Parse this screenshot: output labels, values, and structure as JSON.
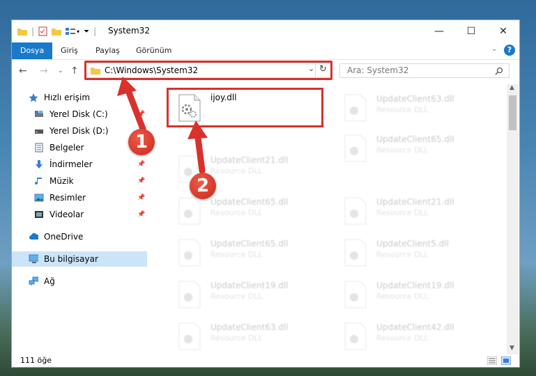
{
  "window": {
    "title": "System32",
    "controls": {
      "minimize": "—",
      "maximize": "☐",
      "close": "✕"
    }
  },
  "ribbon": {
    "tabs": [
      {
        "label": "Dosya",
        "active": true
      },
      {
        "label": "Giriş",
        "active": false
      },
      {
        "label": "Paylaş",
        "active": false
      },
      {
        "label": "Görünüm",
        "active": false
      }
    ],
    "help": "?"
  },
  "address": {
    "path": "C:\\Windows\\System32",
    "highlight_color": "#d9312b"
  },
  "search": {
    "placeholder": "Ara: System32"
  },
  "sidebar": {
    "items": [
      {
        "label": "Hızlı erişim",
        "icon": "star-icon"
      },
      {
        "label": "Yerel Disk (C:)",
        "icon": "drive-icon"
      },
      {
        "label": "Yerel Disk (D:)",
        "icon": "drive-icon"
      },
      {
        "label": "Belgeler",
        "icon": "document-icon"
      },
      {
        "label": "İndirmeler",
        "icon": "download-icon"
      },
      {
        "label": "Müzik",
        "icon": "music-icon"
      },
      {
        "label": "Resimler",
        "icon": "pictures-icon"
      },
      {
        "label": "Videolar",
        "icon": "video-icon"
      },
      {
        "label": "OneDrive",
        "icon": "cloud-icon"
      },
      {
        "label": "Bu bilgisayar",
        "icon": "computer-icon",
        "selected": true
      },
      {
        "label": "Ağ",
        "icon": "network-icon"
      }
    ]
  },
  "files": {
    "highlighted": {
      "name": "ijoy.dll"
    },
    "faded": [
      {
        "name": "UpdateClient63.dll",
        "type": "Resource DLL"
      },
      {
        "name": "UpdateClient21.dll",
        "type": "Resource DLL"
      },
      {
        "name": "UpdateClient65.dll",
        "type": "Resource DLL"
      },
      {
        "name": "UpdateClient65.dll",
        "type": "Resource DLL"
      },
      {
        "name": "UpdateClient21.dll",
        "type": "Resource DLL"
      },
      {
        "name": "UpdateClient65.dll",
        "type": "Resource DLL"
      },
      {
        "name": "UpdateClient5.dll",
        "type": "Resource DLL"
      },
      {
        "name": "UpdateClient19.dll",
        "type": "Resource DLL"
      },
      {
        "name": "UpdateClient19.dll",
        "type": "Resource DLL"
      },
      {
        "name": "UpdateClient63.dll",
        "type": "Resource DLL"
      },
      {
        "name": "UpdateClient42.dll",
        "type": "Resource DLL"
      }
    ]
  },
  "status": {
    "count": "111 öğe"
  },
  "annotations": {
    "step1": "1",
    "step2": "2",
    "color": "#d9312b"
  }
}
